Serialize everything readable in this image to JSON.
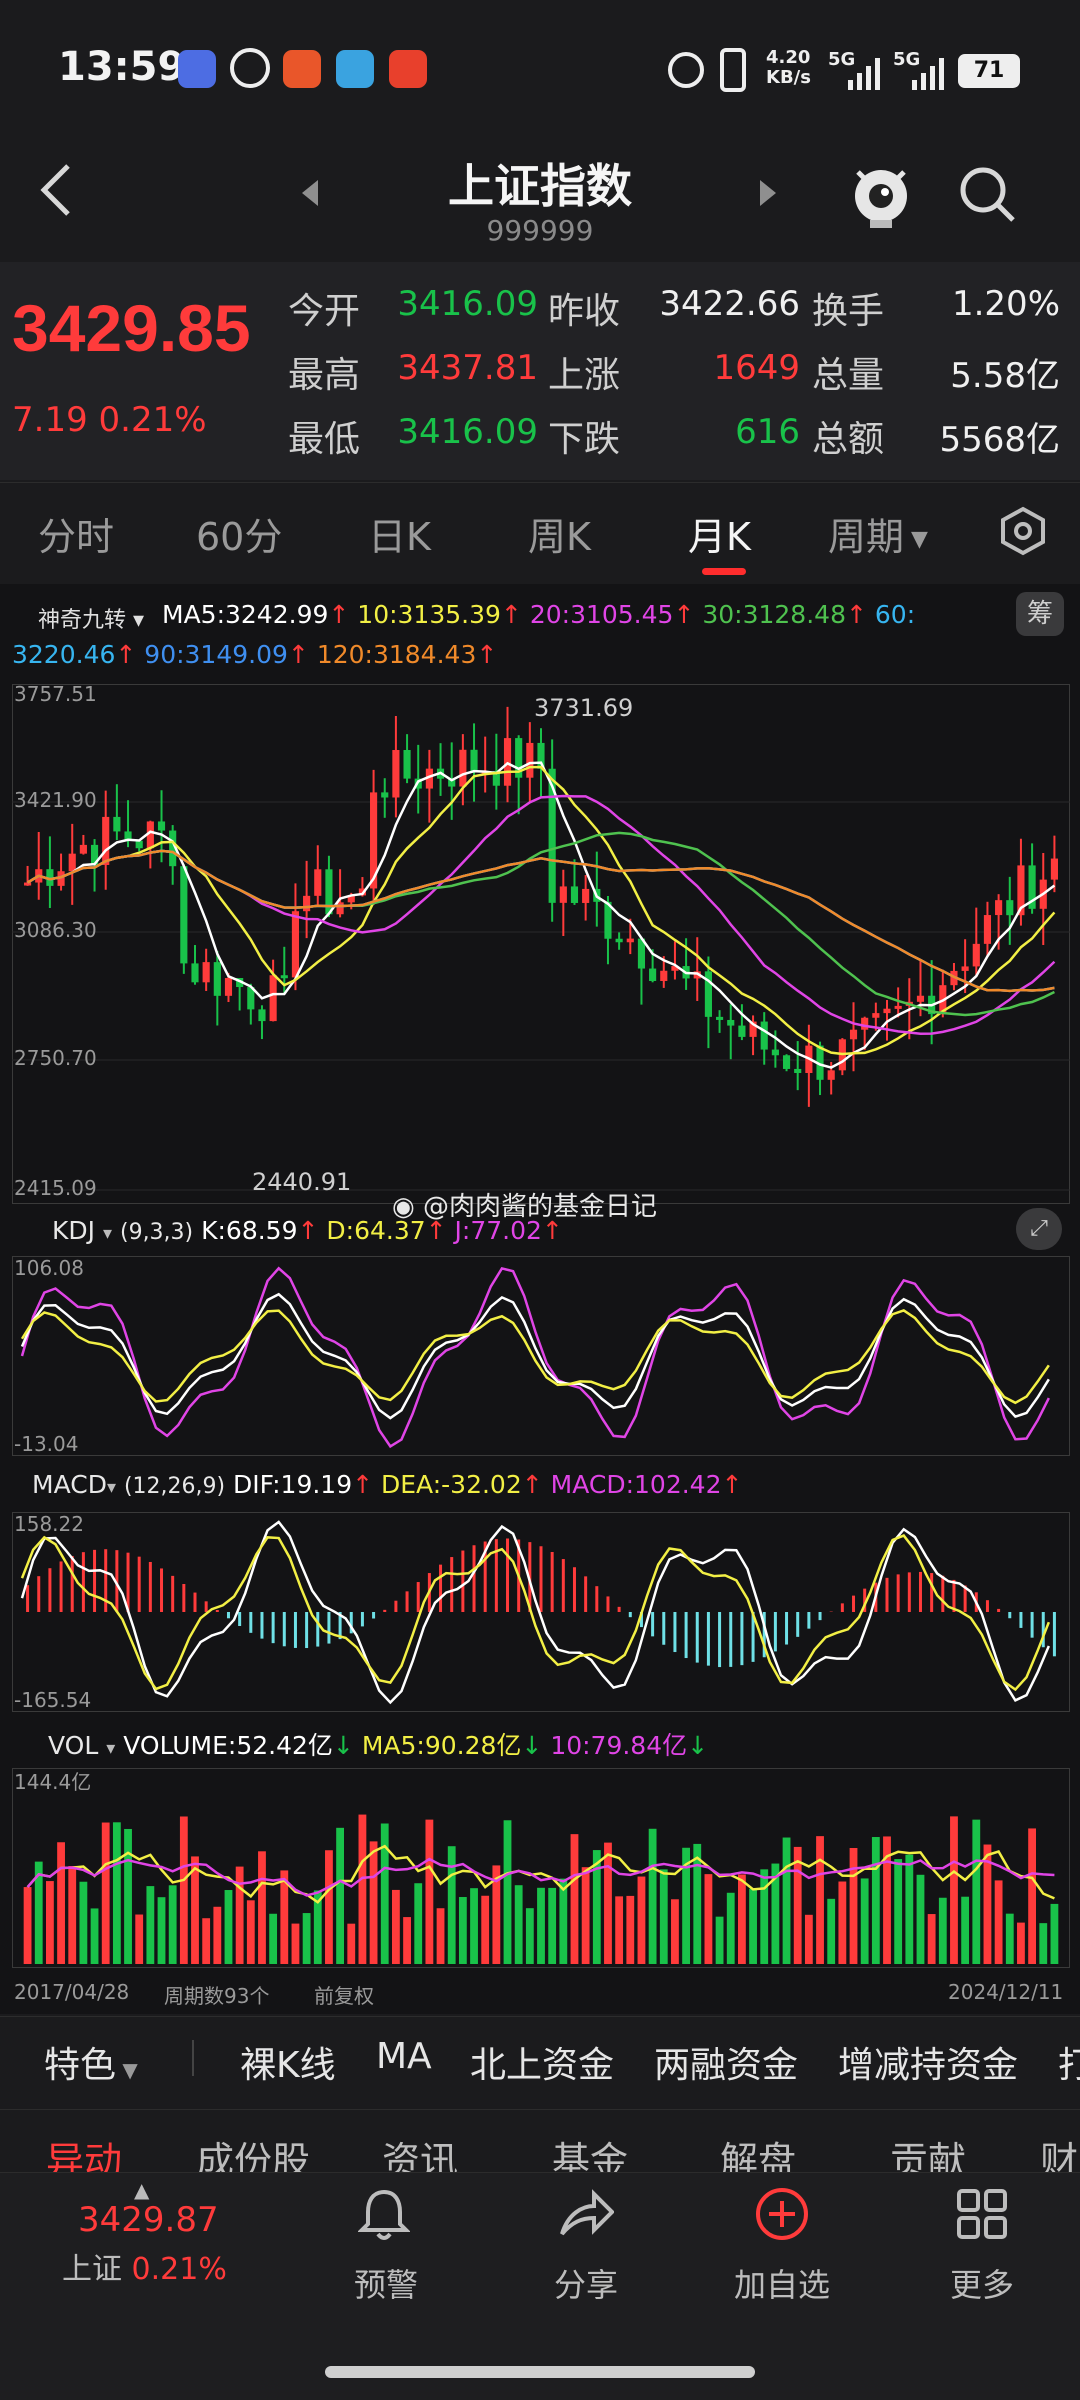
{
  "status_bar": {
    "time": "13:59",
    "net_speed_top": "4.20",
    "net_speed_bottom": "KB/s",
    "sig1": "5G",
    "sig2": "5G",
    "battery": "71"
  },
  "header": {
    "back_icon": "chevron-left-icon",
    "prev_icon": "triangle-left-icon",
    "title": "上证指数",
    "code": "999999",
    "next_icon": "triangle-right-icon",
    "mascot_icon": "mascot-icon",
    "search_icon": "search-icon"
  },
  "quote": {
    "price": "3429.85",
    "change": "7.19",
    "change_pct": "0.21%",
    "rows": [
      [
        {
          "l": "今开",
          "v": "3416.09",
          "c": "green"
        },
        {
          "l": "昨收",
          "v": "3422.66",
          "c": "white"
        },
        {
          "l": "换手",
          "v": "1.20%",
          "c": "white"
        }
      ],
      [
        {
          "l": "最高",
          "v": "3437.81",
          "c": "red"
        },
        {
          "l": "上涨",
          "v": "1649",
          "c": "red"
        },
        {
          "l": "总量",
          "v": "5.58亿",
          "c": "white"
        }
      ],
      [
        {
          "l": "最低",
          "v": "3416.09",
          "c": "green"
        },
        {
          "l": "下跌",
          "v": "616",
          "c": "green"
        },
        {
          "l": "总额",
          "v": "5568亿",
          "c": "white"
        }
      ]
    ]
  },
  "period_tabs": [
    "分时",
    "60分",
    "日K",
    "周K",
    "月K",
    "周期"
  ],
  "period_active": "月K",
  "ma_legend": {
    "indicator": "神奇九转",
    "ma5": "MA5:3242.99",
    "ma10": "10:3135.39",
    "ma20": "20:3105.45",
    "ma30": "30:3128.48",
    "ma60": "60:",
    "ma60v": "3220.46",
    "ma90": "90:3149.09",
    "ma120": "120:3184.43",
    "chip_btn": "筹"
  },
  "kline": {
    "y_labels": [
      "3757.51",
      "3421.90",
      "3086.30",
      "2750.70",
      "2415.09"
    ],
    "high_label": "3731.69",
    "low_label": "2440.91",
    "watermark": "@肉肉酱的基金日记"
  },
  "kdj": {
    "name": "KDJ",
    "params": "(9,3,3)",
    "k": "K:68.59",
    "d": "D:64.37",
    "j": "J:77.02",
    "y_top": "106.08",
    "y_bottom": "-13.04"
  },
  "macd": {
    "name": "MACD",
    "params": "(12,26,9)",
    "dif": "DIF:19.19",
    "dea": "DEA:-32.02",
    "macd": "MACD:102.42",
    "y_top": "158.22",
    "y_bottom": "-165.54"
  },
  "vol": {
    "name": "VOL",
    "volume": "VOLUME:52.42亿",
    "ma5": "MA5:90.28亿",
    "ma10": "10:79.84亿",
    "y_top": "144.4亿"
  },
  "footer_axis": {
    "start": "2017/04/28",
    "count": "周期数93个",
    "adj": "前复权",
    "end": "2024/12/11"
  },
  "feature_bar": [
    "特色",
    "裸K线",
    "MA",
    "北上资金",
    "两融资金",
    "增减持资金",
    "打"
  ],
  "sub_tabs": [
    "异动",
    "成份股",
    "资讯",
    "基金",
    "解盘",
    "贡献",
    "财"
  ],
  "bottom_nav": {
    "index_price": "3429.87",
    "index_name": "上证",
    "index_pct": "0.21%",
    "items": [
      "预警",
      "分享",
      "加自选",
      "更多"
    ]
  },
  "colors": {
    "up": "#ff3b3b",
    "down": "#19c24a",
    "ma5": "#ffffff",
    "ma10": "#f2ef45",
    "ma20": "#e045e6",
    "ma30": "#4fc24f",
    "ma60": "#37b5f0",
    "ma90": "#3f8ff0",
    "ma120": "#f08a2a",
    "hist_neg": "#6fe0e6"
  }
}
